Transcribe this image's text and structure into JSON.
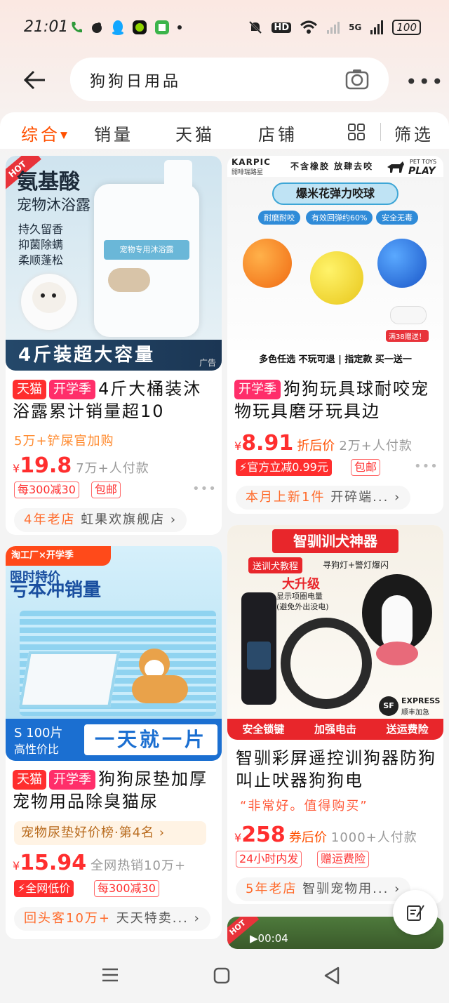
{
  "status_bar": {
    "time": "21:01",
    "network": "5G",
    "battery": "100",
    "hd_label": "HD"
  },
  "search": {
    "query": "狗狗日用品"
  },
  "filters": {
    "tabs": [
      "综合",
      "销量",
      "天猫",
      "店铺"
    ],
    "active": "综合",
    "filter_label": "筛选"
  },
  "products": [
    {
      "image": {
        "hot": "HOT",
        "headline": "氨基酸",
        "subheadline": "宠物沐浴露",
        "features": [
          "持久留香",
          "抑菌除螨",
          "柔顺蓬松"
        ],
        "bottle_label": "宠物专用沐浴露",
        "banner": "4斤装超大容量",
        "ad": "广告"
      },
      "badges": [
        "天猫",
        "开学季"
      ],
      "title": "4斤大桶装沐浴露累计销量超10",
      "subline": "5万+铲屎官加购",
      "price": "19.8",
      "price_suffix": "",
      "sold": "7万+人付款",
      "offers": [
        "每300减30",
        "包邮"
      ],
      "shop": "4年老店",
      "shop_name": "虹果欢旗舰店"
    },
    {
      "image": {
        "brand": "KARPIC",
        "brand_cn": "開啡瑞路星",
        "slogan": "不含橡胶 放肆去咬",
        "pet_toys": "PET TOYS",
        "play": "PLAY",
        "headline": "爆米花弹力咬球",
        "features": [
          "耐磨耐咬",
          "有效回弹约60%",
          "安全无毒"
        ],
        "gift": "满38赠送！",
        "banner": "多色任选 不玩可退 | 指定款 买一送一"
      },
      "badges": [
        "开学季"
      ],
      "title": "狗狗玩具球耐咬宠物玩具磨牙玩具边",
      "price": "8.91",
      "price_suffix": "折后价",
      "sold": "2万+人付款",
      "offers": [
        "官方立减0.99元",
        "包邮"
      ],
      "shop": "本月上新1件",
      "shop_name": "开碎端..."
    },
    {
      "image": {
        "corner": "淘工厂×开学季",
        "headline": "限时特价",
        "subheadline": "亏本冲销量",
        "count": "S 100片",
        "value": "高性价比",
        "banner": "一天就一片"
      },
      "badges": [
        "天猫",
        "开学季"
      ],
      "title": "狗狗尿垫加厚宠物用品除臭猫尿",
      "rank": "宠物尿垫好价榜·第4名",
      "price": "15.94",
      "price_suffix": "",
      "sold": "全网热销10万+",
      "offers": [
        "全网低价",
        "每300减30"
      ],
      "shop": "回头客10万+",
      "shop_name": "天天特卖..."
    },
    {
      "image": {
        "headline": "智驯训犬神器",
        "tutorial": "送训犬教程",
        "lights": "寻狗灯+警灯爆闪",
        "upgrade": "大升级",
        "screen_note_1": "显示项圈电量",
        "screen_note_2": "(避免外出没电)",
        "express": "EXPRESS",
        "express_cn": "顺丰加急",
        "sf": "SF",
        "banner": [
          "安全锁键",
          "加强电击",
          "送运费险"
        ]
      },
      "title": "智驯彩屏遥控训狗器防狗叫止吠器狗狗电",
      "quote": "“非常好。值得购买”",
      "price": "258",
      "price_suffix": "券后价",
      "sold": "1000+人付款",
      "offers": [
        "24小时内发",
        "赠运费险"
      ],
      "shop": "5年老店",
      "shop_name": "智驯宠物用..."
    },
    {
      "image": {
        "hot": "HOT",
        "video_time": "00:04"
      }
    }
  ],
  "colors": {
    "accent": "#ff5000",
    "price_red": "#ff2e2e",
    "tmall_red": "#ff2e2e"
  }
}
